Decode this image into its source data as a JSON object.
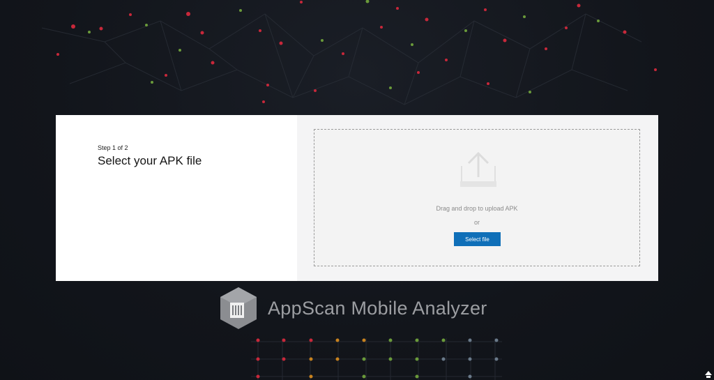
{
  "step": {
    "label": "Step 1 of 2",
    "title": "Select your APK file"
  },
  "upload": {
    "icon": "upload-icon",
    "drop_text": "Drag and drop to upload APK",
    "or_text": "or",
    "select_button_label": "Select file"
  },
  "brand": {
    "logo_icon": "appscan-logo-icon",
    "name": "AppScan Mobile Analyzer"
  },
  "colors": {
    "background": "#12151b",
    "accent": "#0f6fb8",
    "node_red": "#c8283a",
    "node_green": "#6a9a3a",
    "node_orange": "#c8821e"
  }
}
